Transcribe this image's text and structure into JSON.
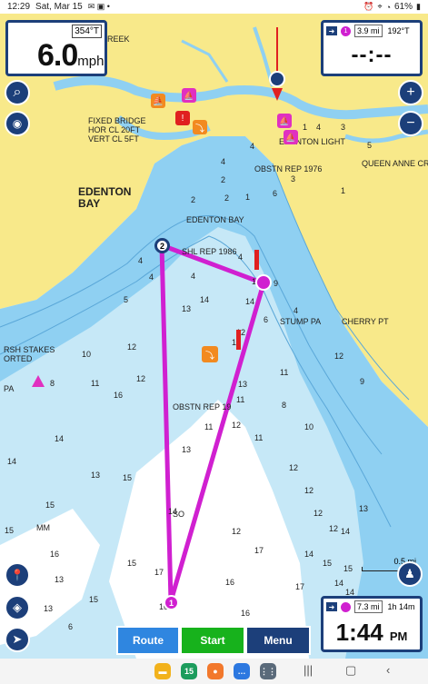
{
  "status_bar": {
    "time": "12:29",
    "date": "Sat, Mar 15",
    "battery": "61%"
  },
  "speed_panel": {
    "heading": "354°T",
    "speed_value": "6.0",
    "speed_unit": "mph"
  },
  "nav_panel": {
    "waypoint_number": "1",
    "distance": "3.9 mi",
    "bearing": "192°T",
    "time_to_waypoint": "--:--"
  },
  "eta_panel": {
    "distance": "7.3 mi",
    "duration": "1h 14m",
    "eta_time": "1:44",
    "eta_ampm": "PM"
  },
  "action_bar": {
    "route_label": "Route",
    "start_label": "Start",
    "menu_label": "Menu"
  },
  "scale": {
    "label": "0.5 mi"
  },
  "map": {
    "labels": {
      "creek": "REEK",
      "fixed_bridge": "FIXED BRIDGE",
      "bridge_hor": "HOR CL 20FT",
      "bridge_vert": "VERT CL 5FT",
      "edenton_light": "EDENTON LIGHT",
      "queen_anne": "QUEEN ANNE CR",
      "obstn_1976": "OBSTN REP 1976",
      "edenton_bay_big": "EDENTON BAY",
      "edenton_bay_small": "EDENTON BAY",
      "shl_rep": "SHL REP 1986",
      "stump_pa": "STUMP PA",
      "cherry_pt": "CHERRY PT",
      "fish_stakes": "RSH STAKES",
      "reported": "ORTED",
      "pa": "PA",
      "obstn_19": "OBSTN REP 19",
      "so": "SO",
      "mm": "MM",
      "six": "6"
    },
    "waypoints": {
      "wp1": "1",
      "wp2": "2"
    },
    "depths": [
      "4",
      "2",
      "3",
      "4",
      "1",
      "3",
      "4",
      "5",
      "4",
      "1",
      "2",
      "1",
      "2",
      "4",
      "4",
      "5",
      "4",
      "4",
      "13",
      "9",
      "4",
      "14",
      "14",
      "13",
      "12",
      "12",
      "6",
      "12",
      "10",
      "8",
      "11",
      "12",
      "11",
      "12",
      "13",
      "11",
      "9",
      "8",
      "11",
      "12",
      "16",
      "10",
      "14",
      "11",
      "13",
      "12",
      "14",
      "13",
      "15",
      "12",
      "14",
      "15",
      "12",
      "13",
      "15",
      "12",
      "14",
      "12",
      "17",
      "14",
      "16",
      "15",
      "15",
      "17",
      "13",
      "16",
      "17",
      "14",
      "15",
      "13",
      "15",
      "16",
      "14",
      "16",
      "6"
    ]
  },
  "taskbar": {
    "calendar_day": "15"
  },
  "colors": {
    "land": "#f8e98a",
    "shallow": "#8fd0f2",
    "deep": "#ffffff",
    "mid": "#c6e8f7",
    "route": "#d020d0",
    "panel_border": "#1c3f7a",
    "start_green": "#17b21c",
    "route_blue": "#2f86e0"
  }
}
